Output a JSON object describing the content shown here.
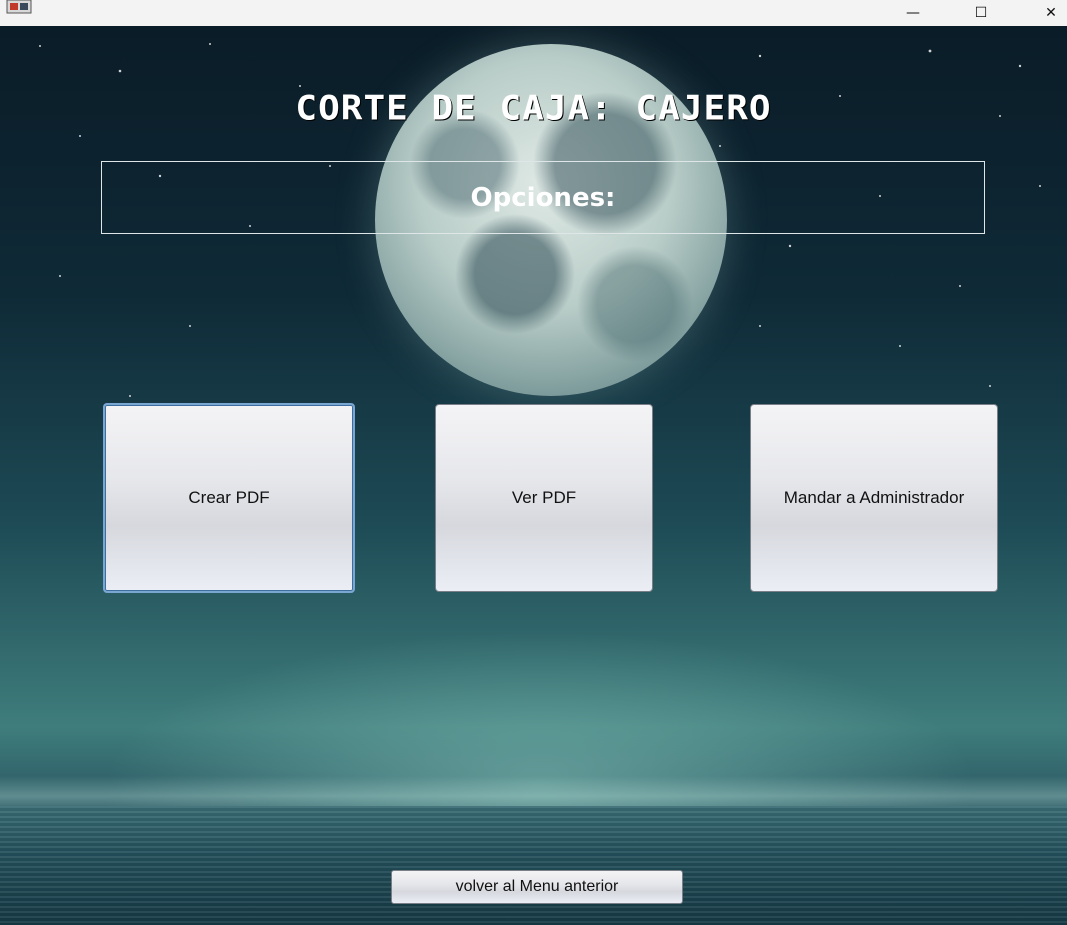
{
  "window": {
    "minimize_glyph": "—",
    "maximize_glyph": "☐",
    "close_glyph": "✕"
  },
  "header": {
    "title": "CORTE DE CAJA: CAJERO"
  },
  "options_panel": {
    "label": "Opciones:"
  },
  "buttons": {
    "crear_pdf": "Crear PDF",
    "ver_pdf": "Ver PDF",
    "mandar_admin": "Mandar a Administrador",
    "volver": "volver al Menu anterior"
  },
  "icons": {
    "app": "java-app-icon",
    "minimize": "minimize-icon",
    "maximize": "maximize-icon",
    "close": "close-icon"
  }
}
